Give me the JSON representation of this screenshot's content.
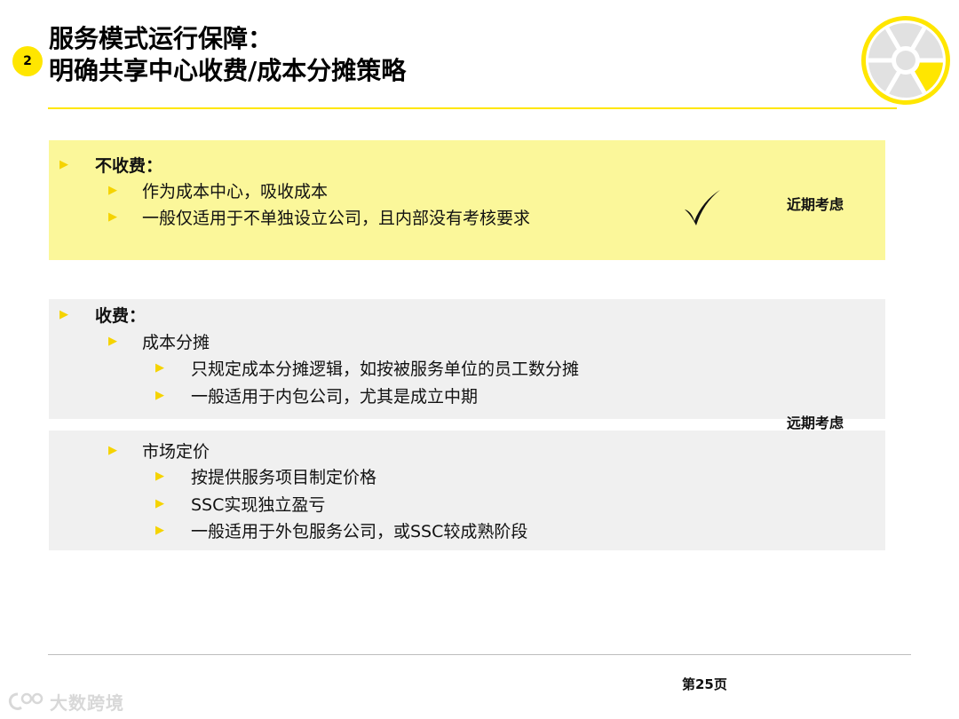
{
  "header": {
    "section_number": "2",
    "title_line1": "服务模式运行保障：",
    "title_line2": "明确共享中心收费/成本分摊策略"
  },
  "colors": {
    "accent": "#FFE600",
    "highlight_panel": "#FBF79A",
    "gray_panel": "#F0F0F0",
    "bullet": "#F5D300"
  },
  "icons": {
    "bullet": "▶",
    "check": "check-icon",
    "logo": "segmented-ring-logo"
  },
  "option_free": {
    "heading": "不收费：",
    "items": [
      "作为成本中心，吸收成本",
      "一般仅适用于不单独设立公司，且内部没有考核要求"
    ],
    "note": "近期考虑"
  },
  "option_charge": {
    "heading": "收费：",
    "cost_allocation": {
      "label": "成本分摊",
      "items": [
        "只规定成本分摊逻辑，如按被服务单位的员工数分摊",
        "一般适用于内包公司，尤其是成立中期"
      ]
    },
    "market_pricing": {
      "label": "市场定价",
      "items": [
        "按提供服务项目制定价格",
        "SSC实现独立盈亏",
        "一般适用于外包服务公司，或SSC较成熟阶段"
      ]
    },
    "note": "远期考虑"
  },
  "footer": {
    "page": "第25页",
    "watermark": "大数跨境"
  }
}
